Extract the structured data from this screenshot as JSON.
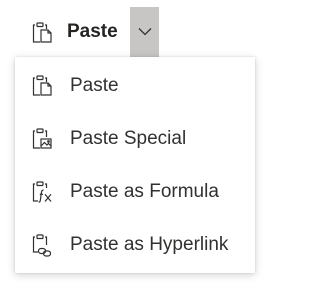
{
  "split_button": {
    "label": "Paste",
    "icon": "paste-icon",
    "arrow_icon": "chevron-down-icon",
    "arrow_bg": "#c8c6c4"
  },
  "menu": {
    "items": [
      {
        "label": "Paste",
        "icon": "paste-icon"
      },
      {
        "label": "Paste Special",
        "icon": "paste-special-icon"
      },
      {
        "label": "Paste as Formula",
        "icon": "paste-formula-icon"
      },
      {
        "label": "Paste as Hyperlink",
        "icon": "paste-hyperlink-icon"
      }
    ]
  }
}
